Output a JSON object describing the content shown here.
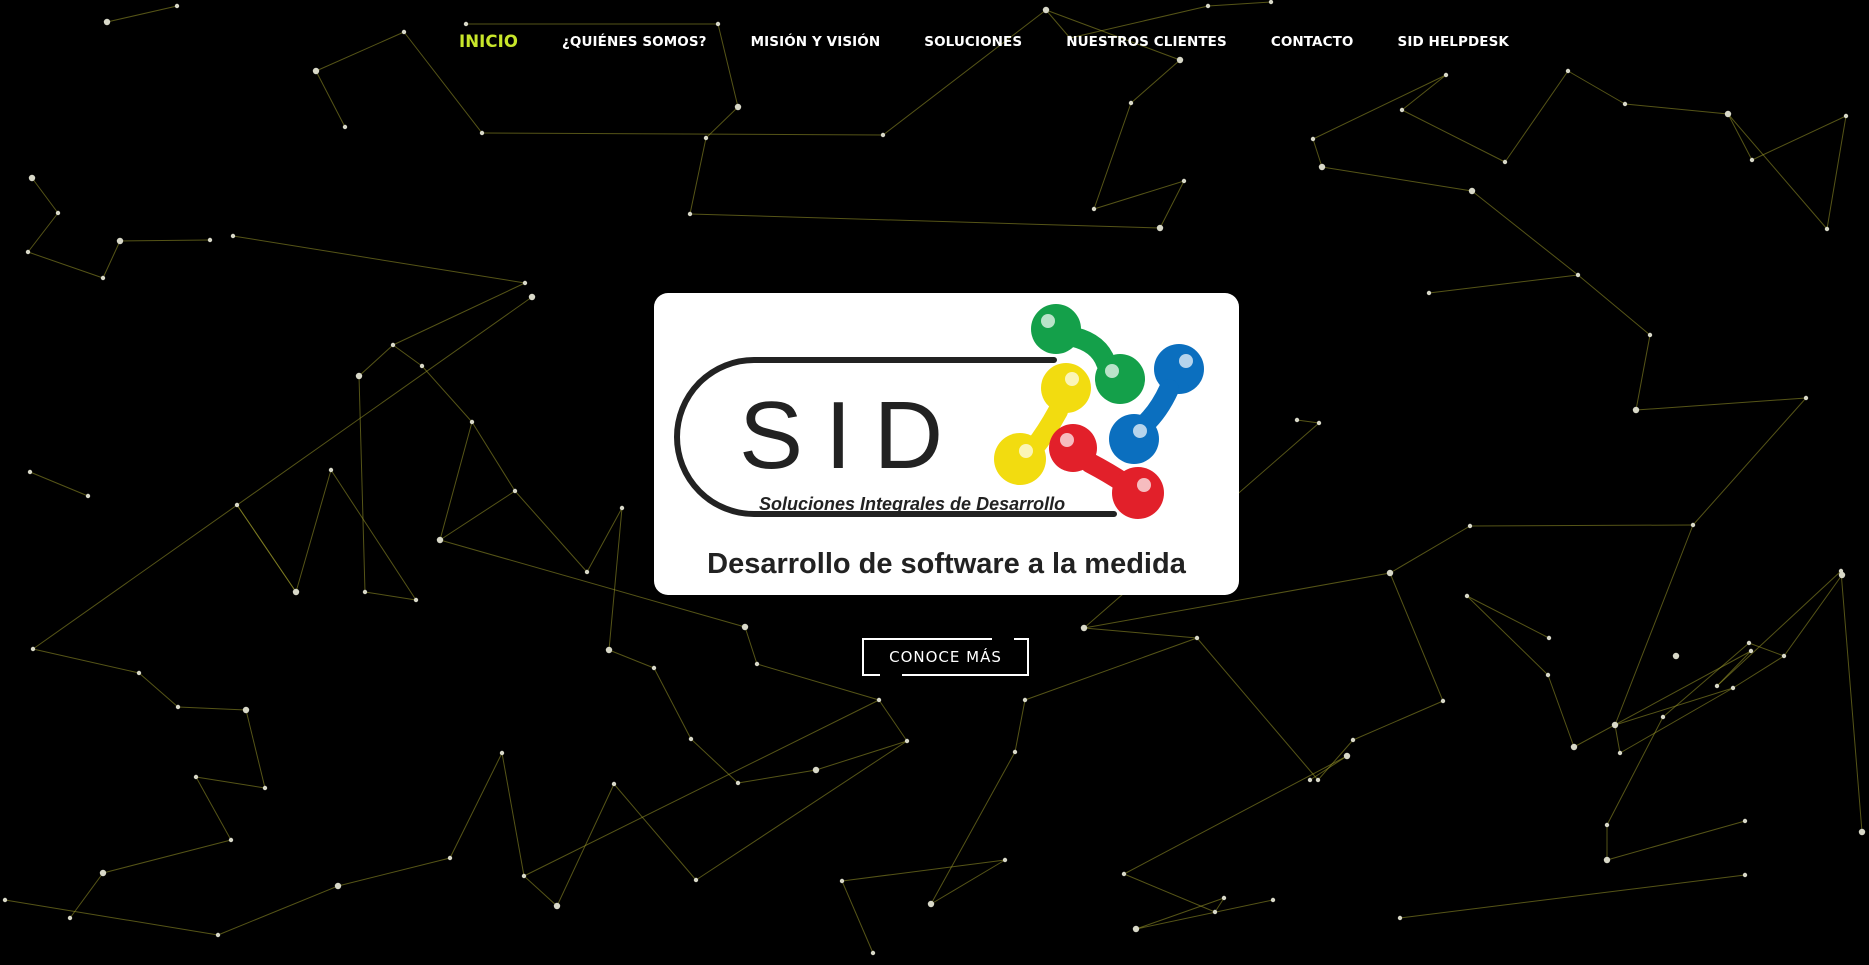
{
  "nav": {
    "items": [
      {
        "label": "INICIO",
        "active": true
      },
      {
        "label": "¿QUIÉNES SOMOS?",
        "active": false
      },
      {
        "label": "MISIÓN Y VISIÓN",
        "active": false
      },
      {
        "label": "SOLUCIONES",
        "active": false
      },
      {
        "label": "NUESTROS CLIENTES",
        "active": false
      },
      {
        "label": "CONTACTO",
        "active": false
      },
      {
        "label": "SID HELPDESK",
        "active": false
      }
    ]
  },
  "logo": {
    "brand": "SID",
    "subtitle": "Soluciones Integrales de Desarrollo",
    "tagline": "Desarrollo de software a la medida"
  },
  "cta": {
    "label": "CONOCE MÁS"
  },
  "colors": {
    "background": "#000000",
    "nav_text": "#ffffff",
    "nav_active": "#c8e62a",
    "network_line": "#9c9a2a",
    "network_node": "#d8d8c8",
    "logo_green": "#14a04a",
    "logo_blue": "#0b6fbf",
    "logo_yellow": "#f2dc10",
    "logo_red": "#e2202a",
    "logo_ink": "#222222"
  },
  "icons": {
    "background": "particle-network-graphic",
    "logo_mark": "molecule-logo-mark"
  }
}
